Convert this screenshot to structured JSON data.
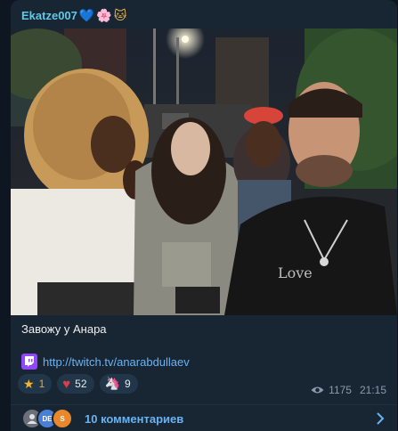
{
  "post": {
    "author": "Ekatze007",
    "author_emojis": [
      "💙",
      "🌸",
      "🐱"
    ],
    "caption": "Завожу у Анара",
    "link_text": "http://twitch.tv/anarabdullaev"
  },
  "reactions": [
    {
      "icon": "star-icon",
      "emoji": "★",
      "count": "1"
    },
    {
      "icon": "heart-icon",
      "emoji": "♥",
      "count": "52"
    },
    {
      "icon": "unicorn-icon",
      "emoji": "🦄",
      "count": "9"
    }
  ],
  "meta": {
    "views": "1175",
    "time": "21:15"
  },
  "comments": {
    "avatars": [
      {
        "label": ""
      },
      {
        "label": "DE"
      },
      {
        "label": "S"
      }
    ],
    "label": "10 комментариев"
  },
  "colors": {
    "background": "#0e1621",
    "bubble": "#182533",
    "author": "#5fc9e6",
    "link": "#6ab3f3",
    "twitch": "#9146ff"
  }
}
